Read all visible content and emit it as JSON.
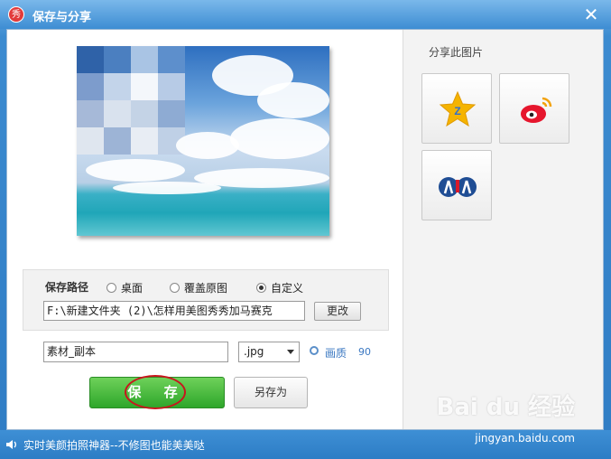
{
  "window": {
    "title": "保存与分享",
    "logo_char": "秀",
    "close_glyph": "✕"
  },
  "save": {
    "path_label": "保存路径",
    "options": [
      {
        "label": "桌面",
        "selected": false
      },
      {
        "label": "覆盖原图",
        "selected": false
      },
      {
        "label": "自定义",
        "selected": true
      }
    ],
    "path_value": "F:\\新建文件夹 (2)\\怎样用美图秀秀加马赛克",
    "change_button": "更改",
    "filename": "素材_副本",
    "extension": ".jpg",
    "quality_label": "画质",
    "quality_value": "90",
    "save_button": "保 存",
    "save_as_button": "另存为"
  },
  "share": {
    "title": "分享此图片",
    "targets": [
      {
        "icon": "qzone-star-icon"
      },
      {
        "icon": "weibo-icon"
      },
      {
        "icon": "renren-icon"
      }
    ]
  },
  "statusbar": {
    "text": "实时美颜拍照神器--不修图也能美美哒"
  },
  "watermark": {
    "logo": "Bai du 经验",
    "url": "jingyan.baidu.com"
  },
  "colors": {
    "title_blue": "#3d8dd3",
    "save_green": "#2ea62a",
    "highlight_red": "#c8161d"
  }
}
